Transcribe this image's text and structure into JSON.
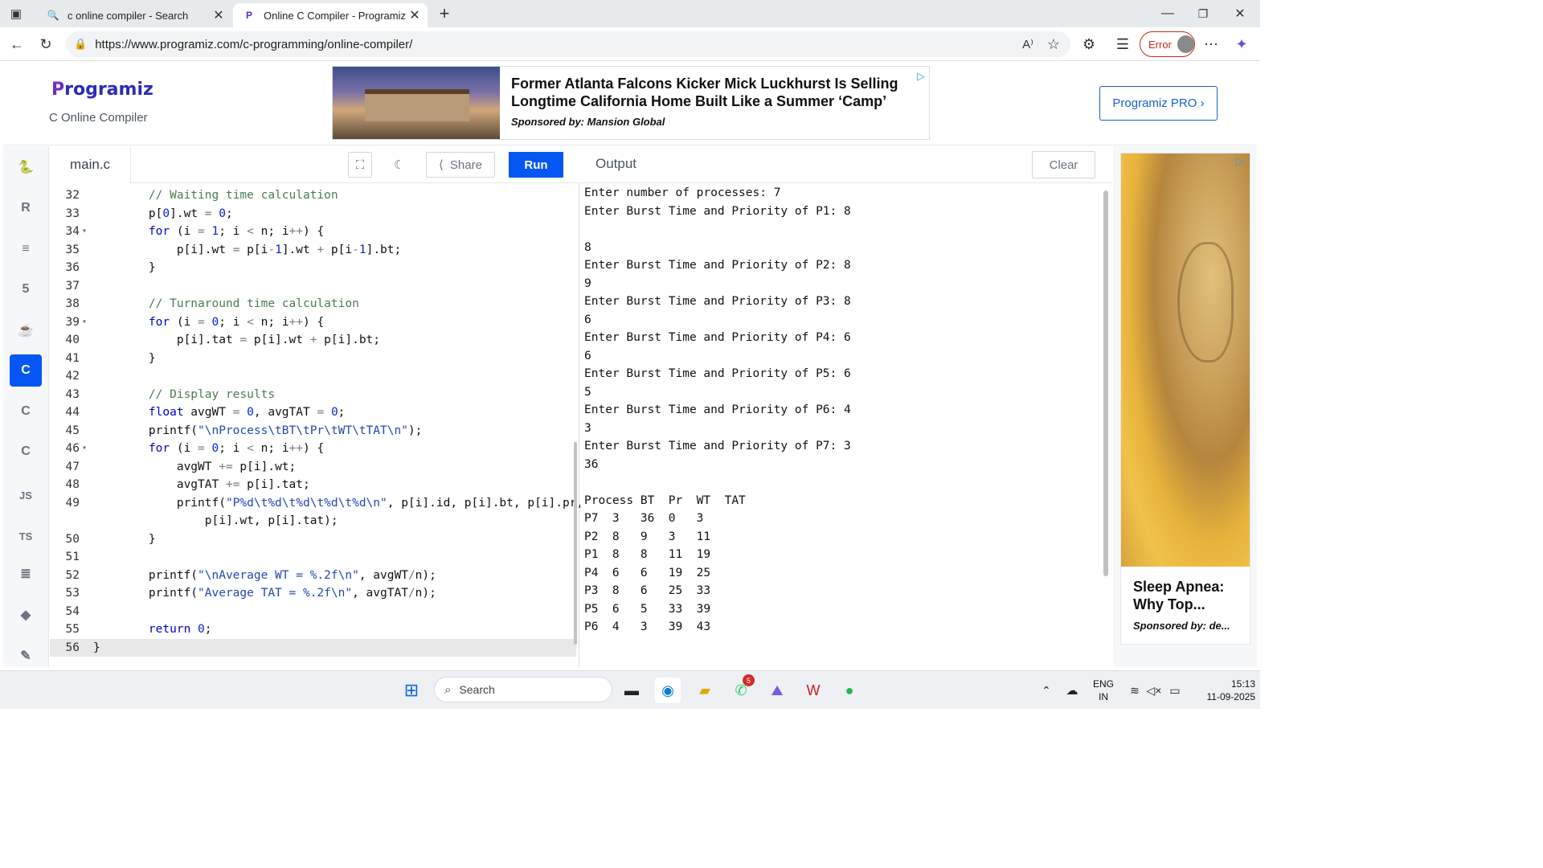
{
  "browser": {
    "tabs": [
      {
        "title": "c online compiler - Search",
        "icon": "search-favicon"
      },
      {
        "title": "Online C Compiler - Programiz",
        "icon": "programiz-favicon"
      }
    ],
    "url": "https://www.programiz.com/c-programming/online-compiler/",
    "error_label": "Error"
  },
  "header": {
    "logo": "Programiz",
    "logo_first": "P",
    "logo_rest": "rogramiz",
    "subtitle": "C Online Compiler",
    "pro_button": "Programiz PRO ›"
  },
  "ad_banner": {
    "headline": "Former Atlanta Falcons Kicker Mick Luckhurst Is Selling Longtime California Home Built Like a Summer ‘Camp’",
    "sponsor": "Sponsored by: Mansion Global"
  },
  "sidebar": {
    "items": [
      {
        "name": "python",
        "label": "🐍"
      },
      {
        "name": "r",
        "label": "R"
      },
      {
        "name": "sql",
        "label": "≡"
      },
      {
        "name": "html",
        "label": "5"
      },
      {
        "name": "java",
        "label": "☕"
      },
      {
        "name": "c",
        "label": "C"
      },
      {
        "name": "csharp",
        "label": "C"
      },
      {
        "name": "cpp",
        "label": "C"
      },
      {
        "name": "js",
        "label": "JS"
      },
      {
        "name": "ts",
        "label": "TS"
      },
      {
        "name": "go",
        "label": "≣"
      },
      {
        "name": "swift",
        "label": "◆"
      },
      {
        "name": "rust",
        "label": "✎"
      }
    ],
    "active": "c"
  },
  "editor": {
    "file_tab": "main.c",
    "share_label": "Share",
    "run_label": "Run",
    "lines": [
      {
        "n": "32",
        "fold": "",
        "code": "// Waiting time calculation"
      },
      {
        "n": "33",
        "fold": "",
        "code": "p[0].wt = 0;"
      },
      {
        "n": "34",
        "fold": "▾",
        "code": "for (i = 1; i < n; i++) {"
      },
      {
        "n": "35",
        "fold": "",
        "code": "    p[i].wt = p[i-1].wt + p[i-1].bt;"
      },
      {
        "n": "36",
        "fold": "",
        "code": "}"
      },
      {
        "n": "37",
        "fold": "",
        "code": ""
      },
      {
        "n": "38",
        "fold": "",
        "code": "// Turnaround time calculation"
      },
      {
        "n": "39",
        "fold": "▾",
        "code": "for (i = 0; i < n; i++) {"
      },
      {
        "n": "40",
        "fold": "",
        "code": "    p[i].tat = p[i].wt + p[i].bt;"
      },
      {
        "n": "41",
        "fold": "",
        "code": "}"
      },
      {
        "n": "42",
        "fold": "",
        "code": ""
      },
      {
        "n": "43",
        "fold": "",
        "code": "// Display results"
      },
      {
        "n": "44",
        "fold": "",
        "code": "float avgWT = 0, avgTAT = 0;"
      },
      {
        "n": "45",
        "fold": "",
        "code": "printf(\"\\nProcess\\tBT\\tPr\\tWT\\tTAT\\n\");"
      },
      {
        "n": "46",
        "fold": "▾",
        "code": "for (i = 0; i < n; i++) {"
      },
      {
        "n": "47",
        "fold": "",
        "code": "    avgWT += p[i].wt;"
      },
      {
        "n": "48",
        "fold": "",
        "code": "    avgTAT += p[i].tat;"
      },
      {
        "n": "49",
        "fold": "",
        "code": "    printf(\"P%d\\t%d\\t%d\\t%d\\t%d\\n\", p[i].id, p[i].bt, p[i].pr,"
      },
      {
        "n": "",
        "fold": "",
        "code": "        p[i].wt, p[i].tat);"
      },
      {
        "n": "50",
        "fold": "",
        "code": "}"
      },
      {
        "n": "51",
        "fold": "",
        "code": ""
      },
      {
        "n": "52",
        "fold": "",
        "code": "printf(\"\\nAverage WT = %.2f\\n\", avgWT/n);"
      },
      {
        "n": "53",
        "fold": "",
        "code": "printf(\"Average TAT = %.2f\\n\", avgTAT/n);"
      },
      {
        "n": "54",
        "fold": "",
        "code": ""
      },
      {
        "n": "55",
        "fold": "",
        "code": "return 0;"
      },
      {
        "n": "56",
        "fold": "",
        "code": "}"
      }
    ]
  },
  "output": {
    "title": "Output",
    "clear_label": "Clear",
    "lines": [
      "Enter number of processes: 7",
      "Enter Burst Time and Priority of P1: 8",
      "",
      "8",
      "Enter Burst Time and Priority of P2: 8",
      "9",
      "Enter Burst Time and Priority of P3: 8",
      "6",
      "Enter Burst Time and Priority of P4: 6",
      "6",
      "Enter Burst Time and Priority of P5: 6",
      "5",
      "Enter Burst Time and Priority of P6: 4",
      "3",
      "Enter Burst Time and Priority of P7: 3",
      "36",
      "",
      "Process BT  Pr  WT  TAT",
      "P7  3   36  0   3",
      "P2  8   9   3   11",
      "P1  8   8   11  19",
      "P4  6   6   19  25",
      "P3  8   6   25  33",
      "P5  6   5   33  39",
      "P6  4   3   39  43"
    ]
  },
  "right_ad": {
    "title": "Sleep Apnea: Why Top...",
    "sponsor": "Sponsored by: de..."
  },
  "taskbar": {
    "search_placeholder": "Search",
    "whatsapp_badge": "5",
    "lang_line1": "ENG",
    "lang_line2": "IN",
    "time": "15:13",
    "date": "11-09-2025"
  },
  "colors": {
    "run_button": "#0556f3",
    "active_sidebar": "#0556f3",
    "keyword": "#0000c8",
    "comment": "#4d7a52"
  }
}
